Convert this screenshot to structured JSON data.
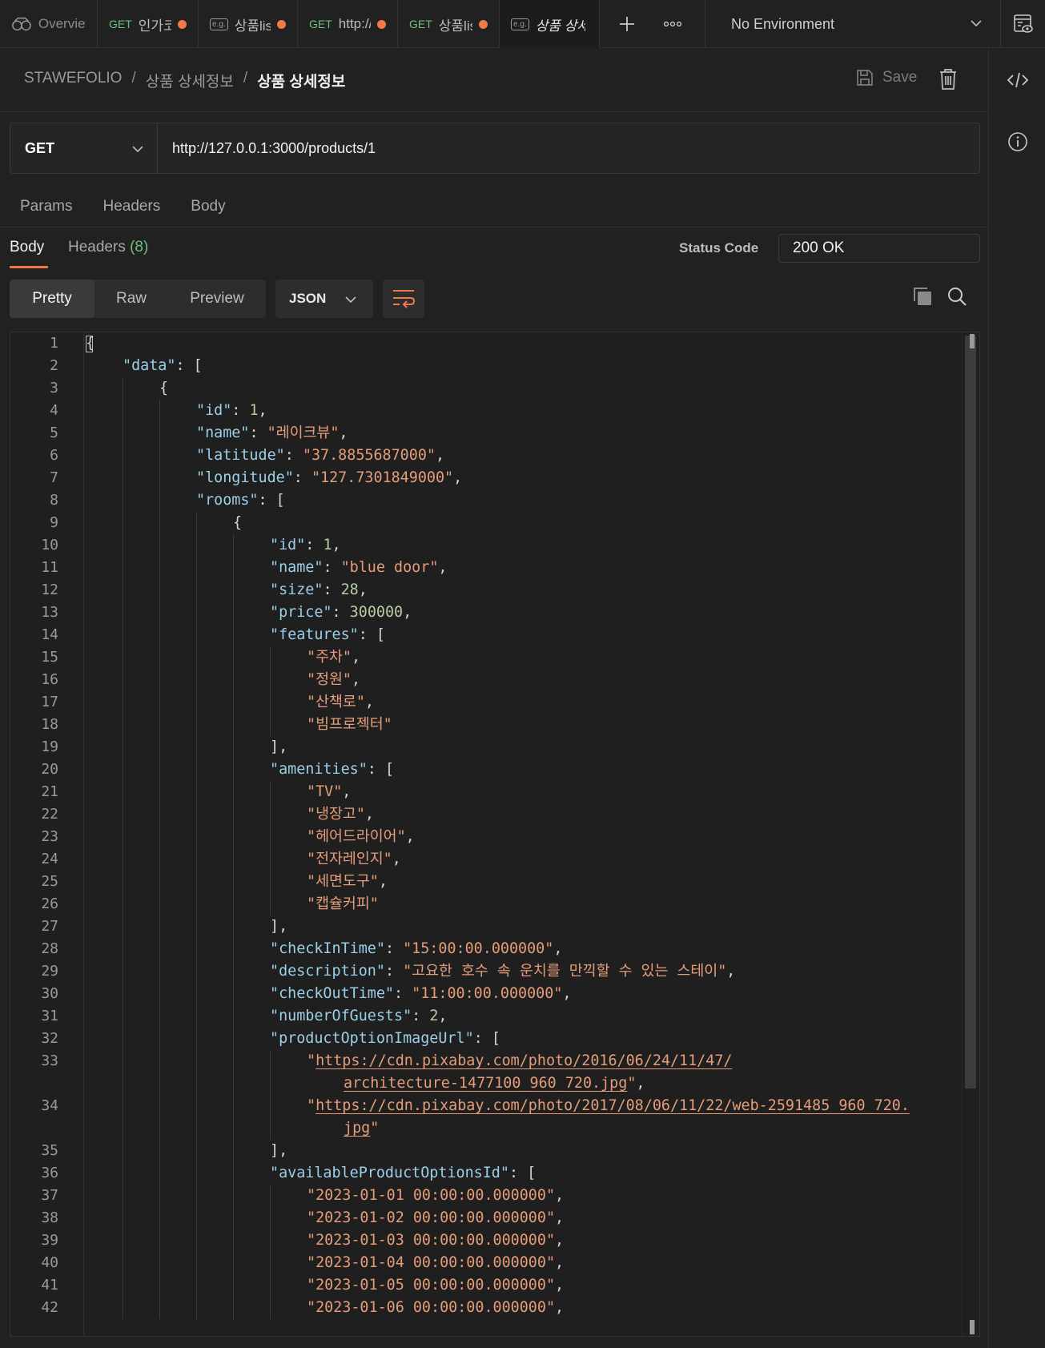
{
  "tabs": [
    {
      "method": "",
      "label": "Overview",
      "unsaved": false,
      "icon": "overview-icon"
    },
    {
      "method": "GET",
      "label": "인가코드",
      "unsaved": true,
      "icon": ""
    },
    {
      "method": "",
      "label": "상품list",
      "unsaved": true,
      "icon": "example-icon"
    },
    {
      "method": "GET",
      "label": "http://",
      "unsaved": true,
      "icon": ""
    },
    {
      "method": "GET",
      "label": "상품list",
      "unsaved": true,
      "icon": ""
    },
    {
      "method": "",
      "label": "상품 상세정보",
      "unsaved": false,
      "icon": "example-icon",
      "active": true
    }
  ],
  "environment": {
    "selected": "No Environment"
  },
  "breadcrumb": {
    "workspace": "STAWEFOLIO",
    "parent": "상품 상세정보",
    "current": "상품 상세정보",
    "separator": "/"
  },
  "header": {
    "save_label": "Save"
  },
  "request": {
    "method": "GET",
    "url": "http://127.0.0.1:3000/products/1"
  },
  "request_tabs": [
    "Params",
    "Headers",
    "Body"
  ],
  "response": {
    "tabs": {
      "body": "Body",
      "headers": "Headers",
      "headers_count": "(8)"
    },
    "status_label": "Status Code",
    "status_value": "200 OK",
    "view_modes": [
      "Pretty",
      "Raw",
      "Preview"
    ],
    "active_view": "Pretty",
    "format": "JSON"
  },
  "code_lines": [
    {
      "n": "1",
      "indent": 0,
      "tokens": [
        [
          "p",
          "{"
        ]
      ]
    },
    {
      "n": "2",
      "indent": 1,
      "tokens": [
        [
          "k",
          "\"data\""
        ],
        [
          "p",
          ": ["
        ]
      ]
    },
    {
      "n": "3",
      "indent": 2,
      "tokens": [
        [
          "p",
          "{"
        ]
      ]
    },
    {
      "n": "4",
      "indent": 3,
      "tokens": [
        [
          "k",
          "\"id\""
        ],
        [
          "p",
          ": "
        ],
        [
          "n",
          "1"
        ],
        [
          "p",
          ","
        ]
      ]
    },
    {
      "n": "5",
      "indent": 3,
      "tokens": [
        [
          "k",
          "\"name\""
        ],
        [
          "p",
          ": "
        ],
        [
          "s",
          "\"레이크뷰\""
        ],
        [
          "p",
          ","
        ]
      ]
    },
    {
      "n": "6",
      "indent": 3,
      "tokens": [
        [
          "k",
          "\"latitude\""
        ],
        [
          "p",
          ": "
        ],
        [
          "s",
          "\"37.8855687000\""
        ],
        [
          "p",
          ","
        ]
      ]
    },
    {
      "n": "7",
      "indent": 3,
      "tokens": [
        [
          "k",
          "\"longitude\""
        ],
        [
          "p",
          ": "
        ],
        [
          "s",
          "\"127.7301849000\""
        ],
        [
          "p",
          ","
        ]
      ]
    },
    {
      "n": "8",
      "indent": 3,
      "tokens": [
        [
          "k",
          "\"rooms\""
        ],
        [
          "p",
          ": ["
        ]
      ]
    },
    {
      "n": "9",
      "indent": 4,
      "tokens": [
        [
          "p",
          "{"
        ]
      ]
    },
    {
      "n": "10",
      "indent": 5,
      "tokens": [
        [
          "k",
          "\"id\""
        ],
        [
          "p",
          ": "
        ],
        [
          "n",
          "1"
        ],
        [
          "p",
          ","
        ]
      ]
    },
    {
      "n": "11",
      "indent": 5,
      "tokens": [
        [
          "k",
          "\"name\""
        ],
        [
          "p",
          ": "
        ],
        [
          "s",
          "\"blue door\""
        ],
        [
          "p",
          ","
        ]
      ]
    },
    {
      "n": "12",
      "indent": 5,
      "tokens": [
        [
          "k",
          "\"size\""
        ],
        [
          "p",
          ": "
        ],
        [
          "n",
          "28"
        ],
        [
          "p",
          ","
        ]
      ]
    },
    {
      "n": "13",
      "indent": 5,
      "tokens": [
        [
          "k",
          "\"price\""
        ],
        [
          "p",
          ": "
        ],
        [
          "n",
          "300000"
        ],
        [
          "p",
          ","
        ]
      ]
    },
    {
      "n": "14",
      "indent": 5,
      "tokens": [
        [
          "k",
          "\"features\""
        ],
        [
          "p",
          ": ["
        ]
      ]
    },
    {
      "n": "15",
      "indent": 6,
      "tokens": [
        [
          "s",
          "\"주차\""
        ],
        [
          "p",
          ","
        ]
      ]
    },
    {
      "n": "16",
      "indent": 6,
      "tokens": [
        [
          "s",
          "\"정원\""
        ],
        [
          "p",
          ","
        ]
      ]
    },
    {
      "n": "17",
      "indent": 6,
      "tokens": [
        [
          "s",
          "\"산책로\""
        ],
        [
          "p",
          ","
        ]
      ]
    },
    {
      "n": "18",
      "indent": 6,
      "tokens": [
        [
          "s",
          "\"빔프로젝터\""
        ]
      ]
    },
    {
      "n": "19",
      "indent": 5,
      "tokens": [
        [
          "p",
          "],"
        ]
      ]
    },
    {
      "n": "20",
      "indent": 5,
      "tokens": [
        [
          "k",
          "\"amenities\""
        ],
        [
          "p",
          ": ["
        ]
      ]
    },
    {
      "n": "21",
      "indent": 6,
      "tokens": [
        [
          "s",
          "\"TV\""
        ],
        [
          "p",
          ","
        ]
      ]
    },
    {
      "n": "22",
      "indent": 6,
      "tokens": [
        [
          "s",
          "\"냉장고\""
        ],
        [
          "p",
          ","
        ]
      ]
    },
    {
      "n": "23",
      "indent": 6,
      "tokens": [
        [
          "s",
          "\"헤어드라이어\""
        ],
        [
          "p",
          ","
        ]
      ]
    },
    {
      "n": "24",
      "indent": 6,
      "tokens": [
        [
          "s",
          "\"전자레인지\""
        ],
        [
          "p",
          ","
        ]
      ]
    },
    {
      "n": "25",
      "indent": 6,
      "tokens": [
        [
          "s",
          "\"세면도구\""
        ],
        [
          "p",
          ","
        ]
      ]
    },
    {
      "n": "26",
      "indent": 6,
      "tokens": [
        [
          "s",
          "\"캡슐커피\""
        ]
      ]
    },
    {
      "n": "27",
      "indent": 5,
      "tokens": [
        [
          "p",
          "],"
        ]
      ]
    },
    {
      "n": "28",
      "indent": 5,
      "tokens": [
        [
          "k",
          "\"checkInTime\""
        ],
        [
          "p",
          ": "
        ],
        [
          "s",
          "\"15:00:00.000000\""
        ],
        [
          "p",
          ","
        ]
      ]
    },
    {
      "n": "29",
      "indent": 5,
      "tokens": [
        [
          "k",
          "\"description\""
        ],
        [
          "p",
          ": "
        ],
        [
          "s",
          "\"고요한 호수 속 운치를 만끽할 수 있는 스테이\""
        ],
        [
          "p",
          ","
        ]
      ]
    },
    {
      "n": "30",
      "indent": 5,
      "tokens": [
        [
          "k",
          "\"checkOutTime\""
        ],
        [
          "p",
          ": "
        ],
        [
          "s",
          "\"11:00:00.000000\""
        ],
        [
          "p",
          ","
        ]
      ]
    },
    {
      "n": "31",
      "indent": 5,
      "tokens": [
        [
          "k",
          "\"numberOfGuests\""
        ],
        [
          "p",
          ": "
        ],
        [
          "n",
          "2"
        ],
        [
          "p",
          ","
        ]
      ]
    },
    {
      "n": "32",
      "indent": 5,
      "tokens": [
        [
          "k",
          "\"productOptionImageUrl\""
        ],
        [
          "p",
          ": ["
        ]
      ]
    },
    {
      "n": "33",
      "indent": 6,
      "tokens": [
        [
          "s",
          "\""
        ],
        [
          "u",
          "https://cdn.pixabay.com/photo/2016/06/24/11/47/"
        ]
      ]
    },
    {
      "n": "",
      "indent": 7,
      "tokens": [
        [
          "u",
          "architecture-1477100_960_720.jpg"
        ],
        [
          "s",
          "\""
        ],
        [
          "p",
          ","
        ]
      ]
    },
    {
      "n": "34",
      "indent": 6,
      "tokens": [
        [
          "s",
          "\""
        ],
        [
          "u",
          "https://cdn.pixabay.com/photo/2017/08/06/11/22/web-2591485_960_720."
        ]
      ]
    },
    {
      "n": "",
      "indent": 7,
      "tokens": [
        [
          "u",
          "jpg"
        ],
        [
          "s",
          "\""
        ]
      ]
    },
    {
      "n": "35",
      "indent": 5,
      "tokens": [
        [
          "p",
          "],"
        ]
      ]
    },
    {
      "n": "36",
      "indent": 5,
      "tokens": [
        [
          "k",
          "\"availableProductOptionsId\""
        ],
        [
          "p",
          ": ["
        ]
      ]
    },
    {
      "n": "37",
      "indent": 6,
      "tokens": [
        [
          "s",
          "\"2023-01-01 00:00:00.000000\""
        ],
        [
          "p",
          ","
        ]
      ]
    },
    {
      "n": "38",
      "indent": 6,
      "tokens": [
        [
          "s",
          "\"2023-01-02 00:00:00.000000\""
        ],
        [
          "p",
          ","
        ]
      ]
    },
    {
      "n": "39",
      "indent": 6,
      "tokens": [
        [
          "s",
          "\"2023-01-03 00:00:00.000000\""
        ],
        [
          "p",
          ","
        ]
      ]
    },
    {
      "n": "40",
      "indent": 6,
      "tokens": [
        [
          "s",
          "\"2023-01-04 00:00:00.000000\""
        ],
        [
          "p",
          ","
        ]
      ]
    },
    {
      "n": "41",
      "indent": 6,
      "tokens": [
        [
          "s",
          "\"2023-01-05 00:00:00.000000\""
        ],
        [
          "p",
          ","
        ]
      ]
    },
    {
      "n": "42",
      "indent": 6,
      "tokens": [
        [
          "s",
          "\"2023-01-06 00:00:00.000000\""
        ],
        [
          "p",
          ","
        ]
      ]
    }
  ],
  "colors": {
    "accent": "#ef7a48",
    "method_get": "#6bc17c",
    "json_key": "#9ccfe9",
    "json_string": "#e59d79",
    "json_number": "#b6cea0",
    "background": "#212121"
  }
}
